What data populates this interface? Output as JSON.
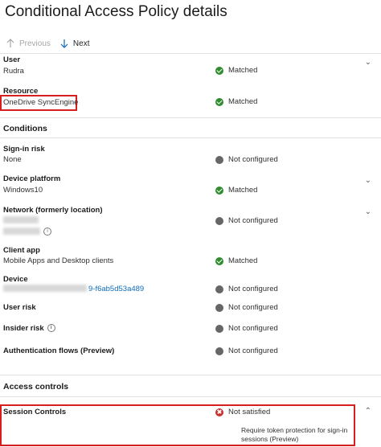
{
  "page": {
    "title": "Conditional Access Policy details"
  },
  "toolbar": {
    "previous_label": "Previous",
    "next_label": "Next"
  },
  "user": {
    "label": "User",
    "value": "Rudra",
    "status": "Matched"
  },
  "resource": {
    "label": "Resource",
    "value": "OneDrive SyncEngine",
    "status": "Matched"
  },
  "conditions": {
    "header": "Conditions",
    "signin_risk": {
      "label": "Sign-in risk",
      "value": "None",
      "status": "Not configured"
    },
    "device_platform": {
      "label": "Device platform",
      "value": "Windows10",
      "status": "Matched"
    },
    "network": {
      "label": "Network (formerly location)",
      "status": "Not configured"
    },
    "client_app": {
      "label": "Client app",
      "value": "Mobile Apps and Desktop clients",
      "status": "Matched"
    },
    "device": {
      "label": "Device",
      "value": "9-f6ab5d53a489",
      "status": "Not configured"
    },
    "user_risk": {
      "label": "User risk",
      "status": "Not configured"
    },
    "insider_risk": {
      "label": "Insider risk",
      "status": "Not configured"
    },
    "auth_flows": {
      "label": "Authentication flows (Preview)",
      "status": "Not configured"
    }
  },
  "access_controls": {
    "header": "Access controls",
    "session_controls": {
      "label": "Session Controls",
      "status": "Not satisfied",
      "note": "Require token protection for sign-in sessions (Preview)"
    }
  },
  "colors": {
    "matched": "#2e8b2e",
    "not_configured": "#666666",
    "not_satisfied": "#c8312e",
    "highlight": "#d71e1e"
  }
}
